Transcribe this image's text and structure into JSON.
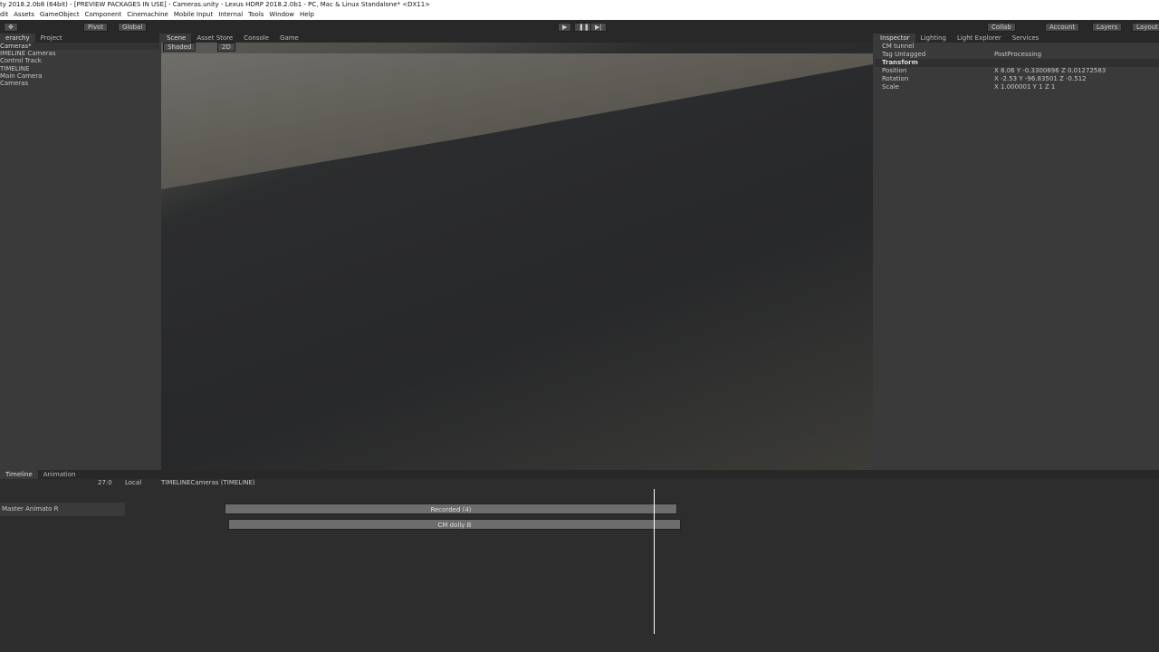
{
  "window": {
    "title": "ty 2018.2.0b8 (64bit) - [PREVIEW PACKAGES IN USE] - Cameras.unity - Lexus HDRP 2018.2.0b1 - PC, Mac & Linux Standalone* <DX11>",
    "menus": [
      "dit",
      "Assets",
      "GameObject",
      "Component",
      "Cinemachine",
      "Mobile Input",
      "Internal",
      "Tools",
      "Window",
      "Help"
    ]
  },
  "toolbar": {
    "pivot": "Pivot",
    "global": "Global",
    "collab": "Collab",
    "account": "Account",
    "layers": "Layers",
    "layout": "Layout"
  },
  "hierarchy": {
    "tabs": [
      "erarchy",
      "Project"
    ],
    "rows": [
      {
        "text": "Cameras*",
        "header": true
      },
      {
        "text": "IMELINE Cameras"
      },
      {
        "text": "Control Track"
      },
      {
        "text": "TIMELINE"
      },
      {
        "text": "Main Camera"
      },
      {
        "text": "Cameras"
      }
    ]
  },
  "scene": {
    "tabs": [
      "Scene",
      "Asset Store",
      "Console",
      "Game"
    ],
    "shaded": "Shaded",
    "mode": "2D"
  },
  "inspector": {
    "tabs": [
      "Inspector",
      "Lighting",
      "Light Explorer",
      "Services"
    ],
    "object_name": "CM tunnel",
    "tag": "Untagged",
    "layer": "PostProcessing",
    "rows": [
      {
        "label": "Transform",
        "section": true
      },
      {
        "label": "Position",
        "value": "X 8.06   Y -0.3300696   Z 0.01272583"
      },
      {
        "label": "Rotation",
        "value": "X -2.53   Y -96.83501   Z -0.512"
      },
      {
        "label": "Scale",
        "value": "X 1.000001   Y 1   Z 1"
      }
    ]
  },
  "timeline": {
    "tabs": [
      "Timeline",
      "Animation"
    ],
    "frame": "27:0",
    "mode": "Local",
    "asset": "TIMELINECameras (TIMELINE)",
    "tracks": [
      {
        "label": "Master Animato R"
      }
    ],
    "clips": [
      {
        "label": "Recorded (4)",
        "track": 0
      },
      {
        "label": "CM dolly B",
        "track": 1
      }
    ]
  }
}
